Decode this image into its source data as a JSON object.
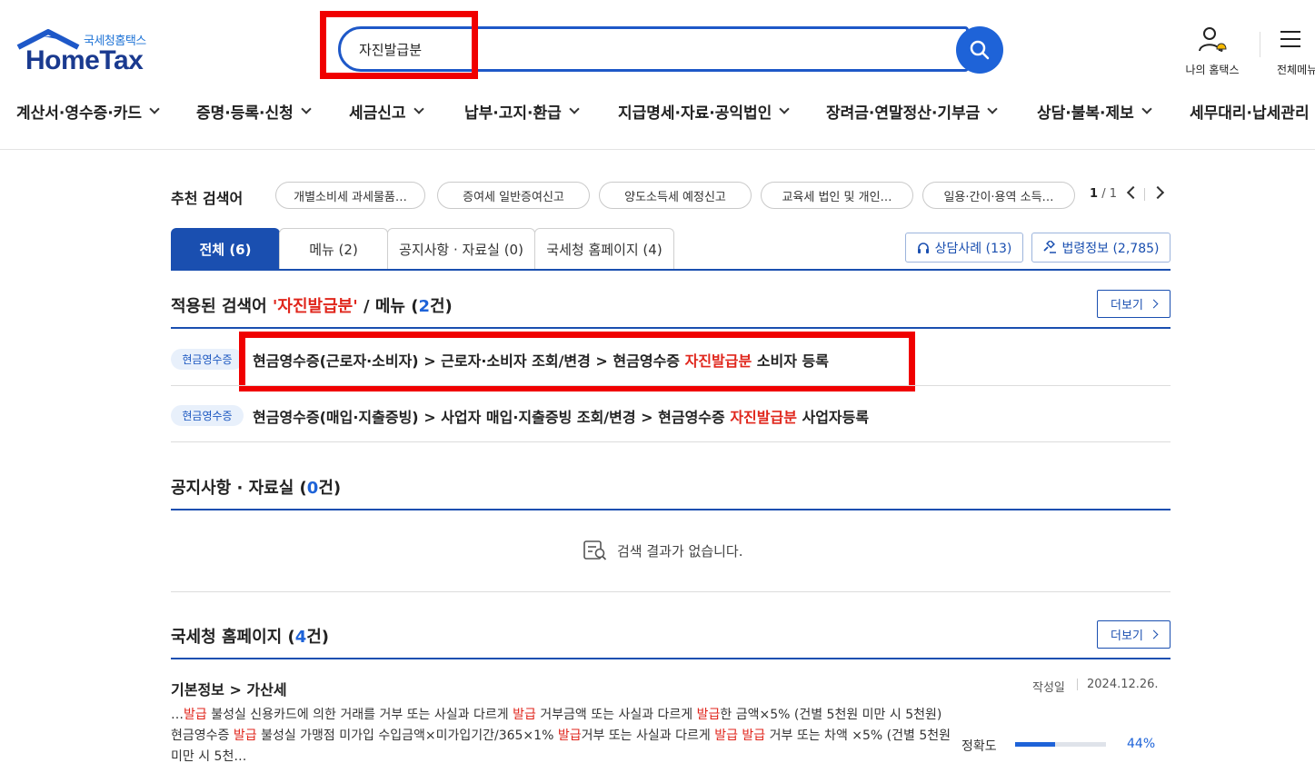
{
  "header": {
    "logo_top": "국세청홈택스",
    "logo_main": "HomeTax",
    "search": {
      "value": "자진발급분",
      "placeholder": ""
    },
    "my_hometax": "나의 홈택스",
    "all_menu": "전체메뉴"
  },
  "gnb": [
    {
      "label": "계산서·영수증·카드"
    },
    {
      "label": "증명·등록·신청"
    },
    {
      "label": "세금신고"
    },
    {
      "label": "납부·고지·환급"
    },
    {
      "label": "지급명세·자료·공익법인"
    },
    {
      "label": "장려금·연말정산·기부금"
    },
    {
      "label": "상담·불복·제보"
    },
    {
      "label": "세무대리·납세관리"
    }
  ],
  "recommend": {
    "label": "추천 검색어",
    "chips": [
      "개별소비세 과세물품…",
      "증여세 일반증여신고",
      "양도소득세 예정신고",
      "교육세 법인 및 개인…",
      "일용·간이·용역 소득…"
    ],
    "page_current": "1",
    "page_total": "/ 1"
  },
  "tabs": [
    {
      "label": "전체 (6)"
    },
    {
      "label": "메뉴 (2)"
    },
    {
      "label": "공지사항 · 자료실 (0)"
    },
    {
      "label": "국세청 홈페이지 (4)"
    }
  ],
  "right_buttons": {
    "consult": "상담사례 (13)",
    "law": "법령정보 (2,785)"
  },
  "menu_section": {
    "title_prefix": "적용된 검색어 ",
    "keyword": "'자진발급분'",
    "title_mid": " / 메뉴 (",
    "count": "2",
    "title_suffix": "건)",
    "more": "더보기",
    "rows": [
      {
        "tag": "현금영수증",
        "before": "현금영수증(근로자·소비자) > 근로자·소비자 조회/변경 > 현금영수증 ",
        "kw": "자진발급분",
        "after": " 소비자 등록"
      },
      {
        "tag": "현금영수증",
        "before": "현금영수증(매입·지출증빙) > 사업자 매입·지출증빙 조회/변경 > 현금영수증 ",
        "kw": "자진발급분",
        "after": " 사업자등록"
      }
    ]
  },
  "notice_section": {
    "title_prefix": "공지사항 · 자료실 (",
    "count": "0",
    "title_suffix": "건)",
    "empty": "검색 결과가 없습니다."
  },
  "homepage_section": {
    "title_prefix": "국세청 홈페이지 (",
    "count": "4",
    "title_suffix": "건)",
    "more": "더보기",
    "article": {
      "title": "기본정보 > 가산세",
      "date_label": "작성일",
      "date": "2024.12.26.",
      "accuracy_label": "정확도",
      "accuracy": 44,
      "accuracy_text": "44%"
    }
  },
  "colors": {
    "brand_blue": "#1a4fb0",
    "accent_blue": "#1e63d8",
    "keyword_red": "#e0261c",
    "highlight_red": "#f00000"
  }
}
